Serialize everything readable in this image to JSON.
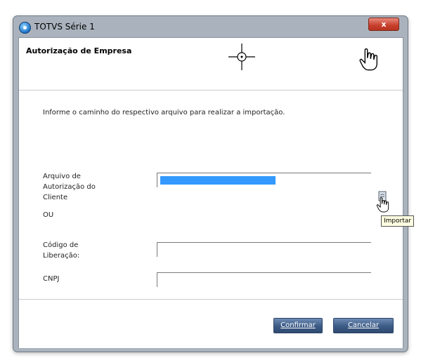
{
  "window": {
    "title": "TOTVS Série 1",
    "close_label": "x"
  },
  "header": {
    "title": "Autorização de Empresa"
  },
  "body": {
    "instruction": "Informe o caminho do respectivo arquivo para realizar a importação.",
    "file_label": [
      "Arquivo de",
      "Autorização do",
      "Cliente"
    ],
    "or_label": "OU",
    "release_code_label": [
      "Código de",
      "Liberação:"
    ],
    "cnpj_label": "CNPJ",
    "file_value": "",
    "release_code_value": "",
    "cnpj_value": "",
    "tooltip": "Importar"
  },
  "footer": {
    "confirm_label": "Confirmar",
    "cancel_label": "Cancelar"
  },
  "icons": {
    "app": "totvs-globe-icon",
    "import": "import-file-icon",
    "crosshair": "crosshair-cursor-icon",
    "hand": "hand-pointer-cursor-icon"
  },
  "colors": {
    "selection": "#3399ff",
    "button": "#3c5b86",
    "close": "#c7402c"
  }
}
